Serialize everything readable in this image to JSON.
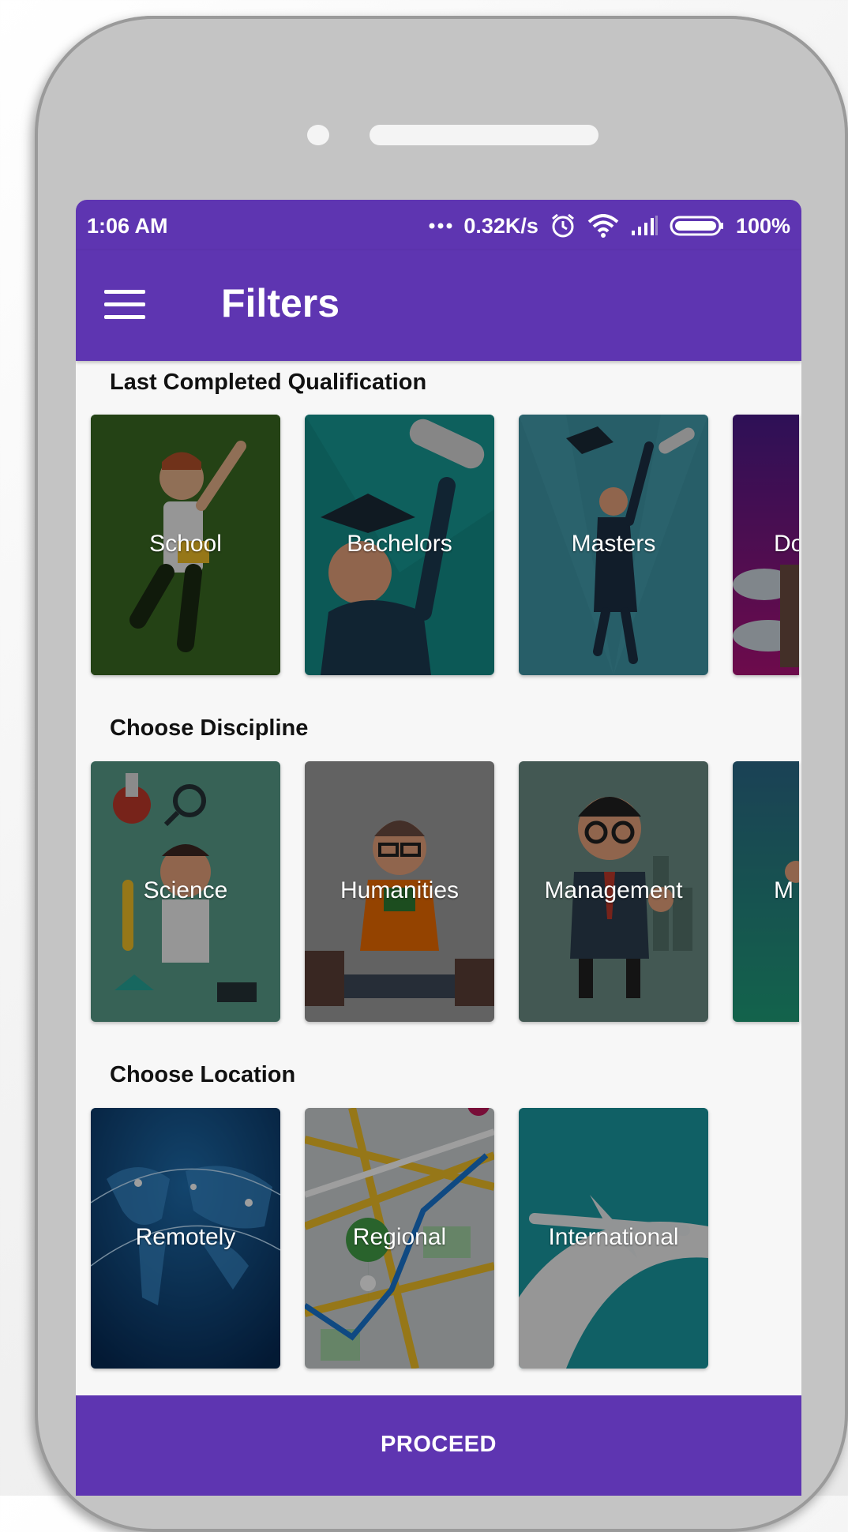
{
  "status_bar": {
    "time": "1:06 AM",
    "net_speed": "0.32K/s",
    "battery": "100%",
    "icons": [
      "dots-icon",
      "alarm-icon",
      "wifi-icon",
      "signal-icon",
      "battery-icon"
    ]
  },
  "app_bar": {
    "menu_icon": "hamburger-menu-icon",
    "title": "Filters"
  },
  "sections": {
    "qualification": {
      "title": "Last Completed Qualification",
      "cards": [
        {
          "label": "School",
          "color": "#2f5b1d"
        },
        {
          "label": "Bachelors",
          "color": "#0f7c7a"
        },
        {
          "label": "Masters",
          "color": "#3a8f9e"
        },
        {
          "label": "Do",
          "color": "#6a1b8a"
        }
      ]
    },
    "discipline": {
      "title": "Choose Discipline",
      "cards": [
        {
          "label": "Science",
          "color": "#4a8a7a"
        },
        {
          "label": "Humanities",
          "color": "#8a8a8a"
        },
        {
          "label": "Management",
          "color": "#5c7a72"
        },
        {
          "label": "M",
          "color": "#2a8a7a"
        }
      ]
    },
    "location": {
      "title": "Choose Location",
      "cards": [
        {
          "label": "Remotely",
          "color": "#0d3a6e"
        },
        {
          "label": "Regional",
          "color": "#9a9a9a"
        },
        {
          "label": "International",
          "color": "#1a8a92"
        }
      ]
    }
  },
  "footer": {
    "proceed_label": "PROCEED"
  },
  "colors": {
    "primary": "#5e35b1",
    "background": "#f7f7f7"
  }
}
